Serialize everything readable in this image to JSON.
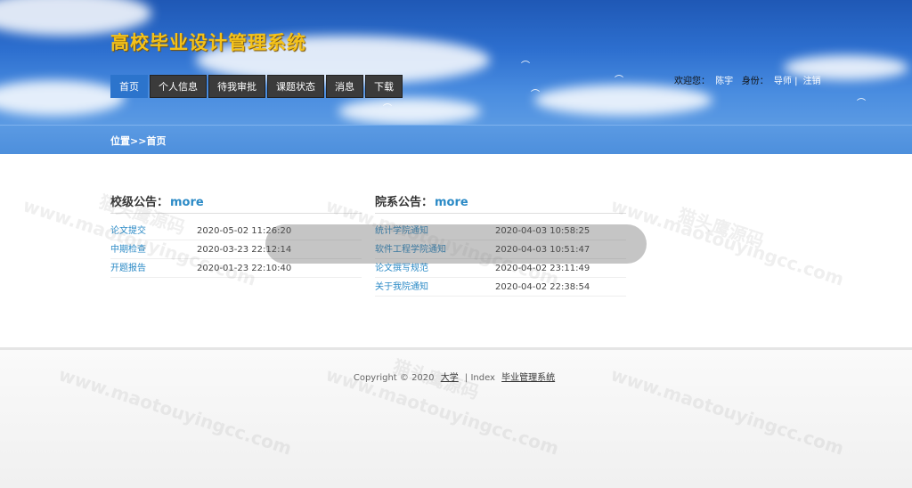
{
  "header": {
    "site_title": "高校毕业设计管理系统",
    "nav": [
      "首页",
      "个人信息",
      "待我审批",
      "课题状态",
      "消息",
      "下载"
    ],
    "user": {
      "welcome_label": "欢迎您：",
      "name": "陈宇",
      "role_label": "身份：",
      "role": "导师",
      "separator": "|",
      "logout": "注销"
    }
  },
  "location": {
    "text": "位置>>首页"
  },
  "school_notices": {
    "title": "校级公告：",
    "more": "more",
    "items": [
      {
        "title": "论文提交",
        "date": "2020-05-02 11:26:20"
      },
      {
        "title": "中期检查",
        "date": "2020-03-23 22:12:14"
      },
      {
        "title": "开题报告",
        "date": "2020-01-23 22:10:40"
      }
    ]
  },
  "dept_notices": {
    "title": "院系公告：",
    "more": "more",
    "items": [
      {
        "title": "统计学院通知",
        "date": "2020-04-03 10:58:25"
      },
      {
        "title": "软件工程学院通知",
        "date": "2020-04-03 10:51:47"
      },
      {
        "title": "论文撰写规范",
        "date": "2020-04-02 23:11:49"
      },
      {
        "title": "关于我院通知",
        "date": "2020-04-02 22:38:54"
      }
    ]
  },
  "footer": {
    "copyright": "Copyright © 2020",
    "link1": "大学",
    "sep": "| Index",
    "link2": "毕业管理系统"
  },
  "watermark": {
    "text1": "猫头鹰源码",
    "text2": "www.maotouyingcc.com"
  }
}
